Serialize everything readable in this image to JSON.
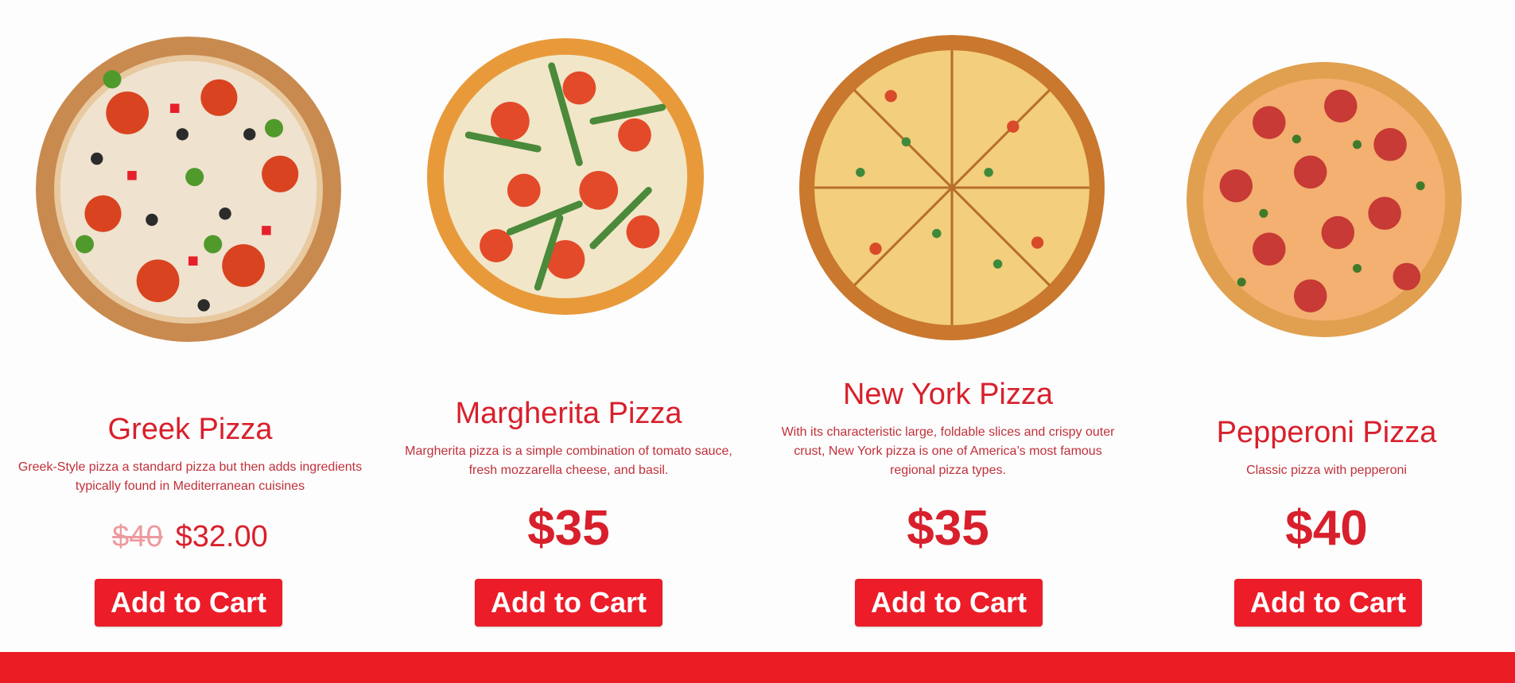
{
  "colors": {
    "accent": "#ec1c28",
    "title": "#d8202c",
    "old_price": "#ec9aa0",
    "footer": "#ec1c24"
  },
  "products": [
    {
      "name": "Greek Pizza",
      "description": "Greek-Style pizza a standard pizza but then adds ingredients typically found in Mediterranean cuisines",
      "old_price": "$40",
      "price": "$32.00",
      "button": "Add to Cart",
      "image_icon": "greek-pizza-image"
    },
    {
      "name": "Margherita Pizza",
      "description": "Margherita pizza is a simple combination of tomato sauce, fresh mozzarella cheese, and basil.",
      "price": "$35",
      "button": "Add to Cart",
      "image_icon": "margherita-pizza-image"
    },
    {
      "name": "New York Pizza",
      "description": "With its characteristic large, foldable slices and crispy outer crust, New York pizza is one of America’s most famous regional pizza types.",
      "price": "$35",
      "button": "Add to Cart",
      "image_icon": "new-york-pizza-image"
    },
    {
      "name": "Pepperoni Pizza",
      "description": "Classic pizza with pepperoni",
      "price": "$40",
      "button": "Add to Cart",
      "image_icon": "pepperoni-pizza-image"
    }
  ]
}
